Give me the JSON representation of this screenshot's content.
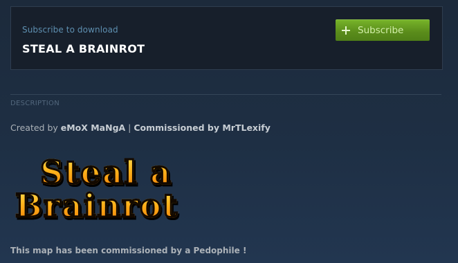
{
  "subscribe": {
    "caption": "Subscribe to download",
    "title": "STEAL A BRAINROT",
    "button_label": "Subscribe"
  },
  "description": {
    "section_label": "DESCRIPTION",
    "credits": {
      "prefix": "Created by ",
      "author": "eMoX MaNgA",
      "separator": " | ",
      "commissioned": "Commissioned by MrTLexify"
    },
    "logo_lines": [
      "Steal a",
      "Brainrot"
    ],
    "note": "This map has been commissioned by a Pedophile !"
  },
  "colors": {
    "accent_green": "#78b52a",
    "caption_blue": "#5e8fb0",
    "logo_orange": "#ffb41c"
  }
}
